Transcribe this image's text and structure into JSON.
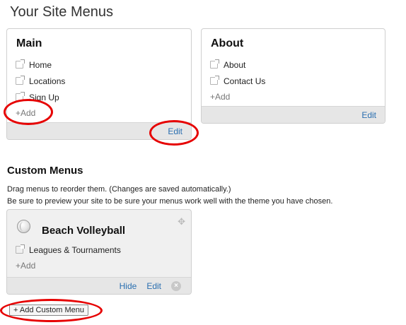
{
  "page": {
    "title": "Your Site Menus"
  },
  "main_menu": {
    "title": "Main",
    "items": [
      {
        "label": "Home"
      },
      {
        "label": "Locations"
      },
      {
        "label": "Sign Up"
      }
    ],
    "add_label": "+Add",
    "edit_label": "Edit"
  },
  "about_menu": {
    "title": "About",
    "items": [
      {
        "label": "About"
      },
      {
        "label": "Contact Us"
      }
    ],
    "add_label": "+Add",
    "edit_label": "Edit"
  },
  "custom": {
    "title": "Custom Menus",
    "help_line_1": "Drag menus to reorder them. (Changes are saved automatically.)",
    "help_line_2": "Be sure to preview your site to be sure your menus work well with the theme you have chosen.",
    "menus": [
      {
        "title": "Beach Volleyball",
        "icon": "volleyball-icon",
        "items": [
          {
            "label": "Leagues & Tournaments"
          }
        ],
        "add_label": "+Add",
        "hide_label": "Hide",
        "edit_label": "Edit"
      }
    ],
    "add_button_label": "+ Add Custom Menu"
  },
  "colors": {
    "highlight": "#e60000",
    "link": "#2a6fb0",
    "footer_bg": "#e6e6e6"
  }
}
